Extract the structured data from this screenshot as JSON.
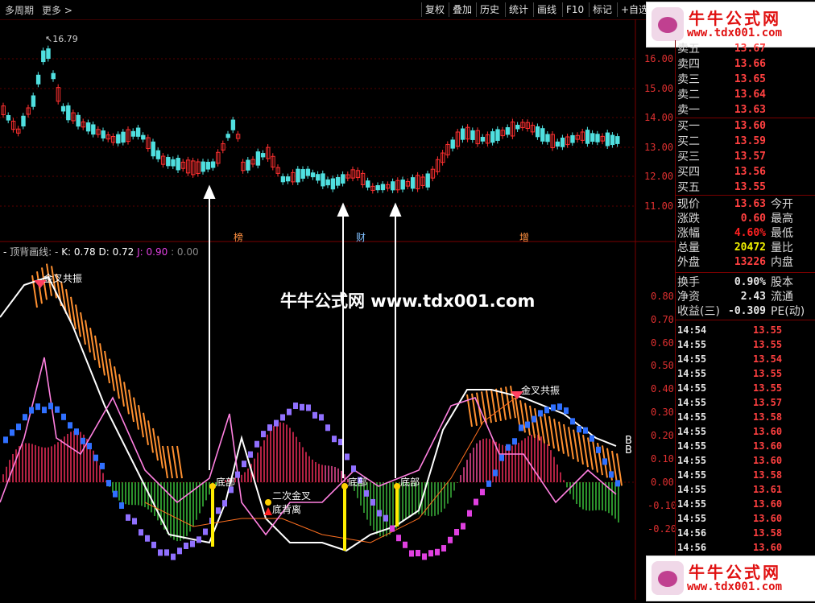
{
  "topbar": {
    "period": "多周期",
    "more": "更多 >",
    "buttons": [
      "复权",
      "叠加",
      "历史",
      "统计",
      "画线",
      "F10",
      "标记",
      "+自选"
    ]
  },
  "price_chart": {
    "high_label": "16.79",
    "y_ticks": [
      "16.00",
      "15.00",
      "14.00",
      "13.00",
      "12.00",
      "11.00"
    ],
    "markers": [
      "榜",
      "财",
      "增"
    ]
  },
  "indicator": {
    "name": "顶背画线:",
    "k_label": "K: 0.78",
    "d_label": "D: 0.72",
    "j_label": "J: 0.90",
    "extra": ": 0.00",
    "y_ticks": [
      "0.80",
      "0.70",
      "0.60",
      "0.50",
      "0.40",
      "0.30",
      "0.20",
      "0.10",
      "0.00",
      "-0.10",
      "-0.20"
    ],
    "annotations": {
      "jincha1": "金叉共振",
      "jincha2": "金叉共振",
      "dibu1": "底部",
      "dibu2": "底部",
      "dibu3": "底部",
      "ercijincha": "二次金叉",
      "dibeili": "底背离",
      "b1": "B",
      "b2": "B"
    }
  },
  "watermark": "牛牛公式网 www.tdx001.com",
  "logo": {
    "cn": "牛牛公式网",
    "url": "www.tdx001.com"
  },
  "quote": {
    "asks": [
      {
        "k": "卖五",
        "v": "13.67"
      },
      {
        "k": "卖四",
        "v": "13.66"
      },
      {
        "k": "卖三",
        "v": "13.65"
      },
      {
        "k": "卖二",
        "v": "13.64"
      },
      {
        "k": "卖一",
        "v": "13.63"
      }
    ],
    "bids": [
      {
        "k": "买一",
        "v": "13.60"
      },
      {
        "k": "买二",
        "v": "13.59"
      },
      {
        "k": "买三",
        "v": "13.57"
      },
      {
        "k": "买四",
        "v": "13.56"
      },
      {
        "k": "买五",
        "v": "13.55"
      }
    ],
    "stats1": [
      {
        "k": "现价",
        "v": "13.63",
        "k2": "今开",
        "c": "#ff4040"
      },
      {
        "k": "涨跌",
        "v": "0.60",
        "k2": "最高",
        "c": "#ff4040"
      },
      {
        "k": "涨幅",
        "v": "4.60%",
        "k2": "最低",
        "c": "#ff2020"
      },
      {
        "k": "总量",
        "v": "20472",
        "k2": "量比",
        "c": "#f0f000"
      },
      {
        "k": "外盘",
        "v": "13226",
        "k2": "内盘",
        "c": "#ff4040"
      }
    ],
    "stats2": [
      {
        "k": "换手",
        "v": "0.90%",
        "k2": "股本",
        "c": "#e8e8e8"
      },
      {
        "k": "净资",
        "v": "2.43",
        "k2": "流通",
        "c": "#e8e8e8"
      },
      {
        "k": "收益(三)",
        "v": "-0.309",
        "k2": "PE(动)",
        "c": "#e8e8e8"
      }
    ],
    "ticks": [
      {
        "t": "14:54",
        "p": "13.55"
      },
      {
        "t": "14:55",
        "p": "13.55"
      },
      {
        "t": "14:55",
        "p": "13.54"
      },
      {
        "t": "14:55",
        "p": "13.55"
      },
      {
        "t": "14:55",
        "p": "13.55"
      },
      {
        "t": "14:55",
        "p": "13.57"
      },
      {
        "t": "14:55",
        "p": "13.58"
      },
      {
        "t": "14:55",
        "p": "13.60"
      },
      {
        "t": "14:55",
        "p": "13.60"
      },
      {
        "t": "14:55",
        "p": "13.60"
      },
      {
        "t": "14:55",
        "p": "13.58"
      },
      {
        "t": "14:55",
        "p": "13.61"
      },
      {
        "t": "14:55",
        "p": "13.60"
      },
      {
        "t": "14:55",
        "p": "13.60"
      },
      {
        "t": "14:56",
        "p": "13.58"
      },
      {
        "t": "14:56",
        "p": "13.60"
      }
    ]
  }
}
